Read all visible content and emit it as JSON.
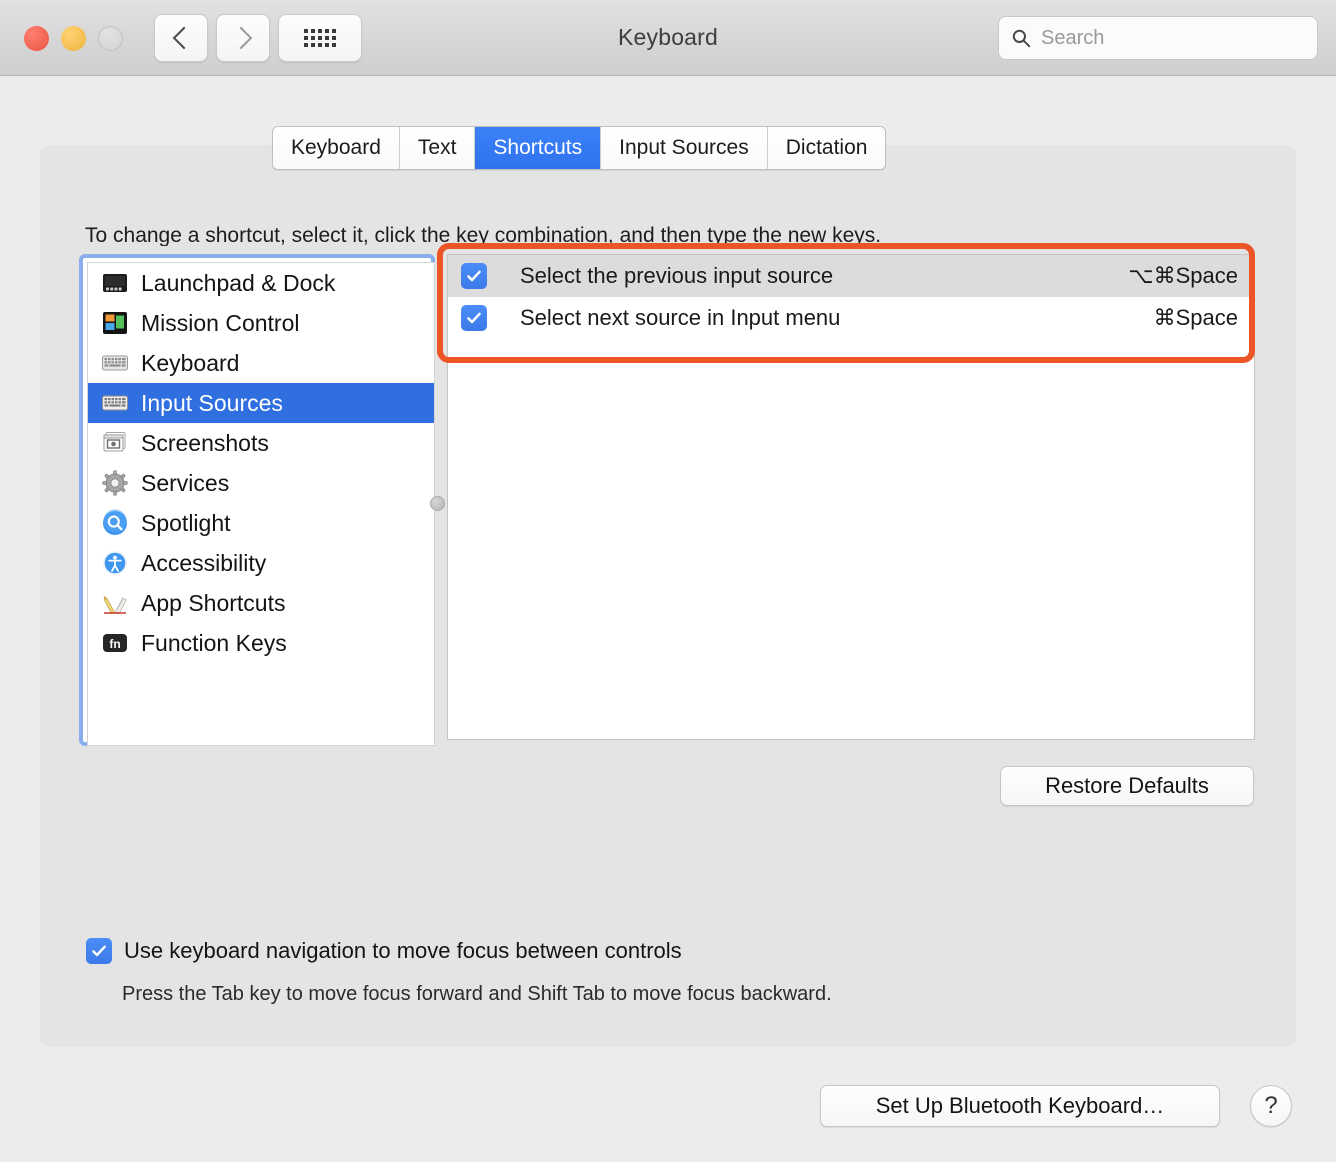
{
  "window": {
    "title": "Keyboard",
    "traffic_lights": [
      "close",
      "minimize",
      "zoom"
    ],
    "back_label": "Back",
    "forward_label": "Forward",
    "grid_label": "Show All"
  },
  "search": {
    "placeholder": "Search",
    "value": "",
    "icon": "search-icon"
  },
  "tabs": [
    {
      "label": "Keyboard",
      "active": false
    },
    {
      "label": "Text",
      "active": false
    },
    {
      "label": "Shortcuts",
      "active": true
    },
    {
      "label": "Input Sources",
      "active": false
    },
    {
      "label": "Dictation",
      "active": false
    }
  ],
  "instruction": "To change a shortcut, select it, click the key combination, and then type the new keys.",
  "sidebar": {
    "items": [
      {
        "label": "Launchpad & Dock",
        "icon": "launchpad-dock-icon",
        "selected": false
      },
      {
        "label": "Mission Control",
        "icon": "mission-control-icon",
        "selected": false
      },
      {
        "label": "Keyboard",
        "icon": "keyboard-icon",
        "selected": false
      },
      {
        "label": "Input Sources",
        "icon": "input-sources-icon",
        "selected": true
      },
      {
        "label": "Screenshots",
        "icon": "screenshots-icon",
        "selected": false
      },
      {
        "label": "Services",
        "icon": "services-gear-icon",
        "selected": false
      },
      {
        "label": "Spotlight",
        "icon": "spotlight-icon",
        "selected": false
      },
      {
        "label": "Accessibility",
        "icon": "accessibility-icon",
        "selected": false
      },
      {
        "label": "App Shortcuts",
        "icon": "app-shortcuts-icon",
        "selected": false
      },
      {
        "label": "Function Keys",
        "icon": "function-keys-icon",
        "selected": false
      }
    ]
  },
  "shortcuts": [
    {
      "checked": true,
      "label": "Select the previous input source",
      "key": "⌥⌘Space"
    },
    {
      "checked": true,
      "label": "Select next source in Input menu",
      "key": "⌘Space"
    }
  ],
  "buttons": {
    "restore_defaults": "Restore Defaults",
    "bluetooth_keyboard": "Set Up Bluetooth Keyboard…",
    "help": "?"
  },
  "keyboard_navigation": {
    "checked": true,
    "label": "Use keyboard navigation to move focus between controls",
    "note": "Press the Tab key to move focus forward and Shift Tab to move focus backward."
  },
  "colors": {
    "accent_blue": "#2f6fe0",
    "tab_active_blue": "#3b82f8",
    "checkbox_blue": "#4b8df8",
    "annotation_red": "#ec5526",
    "focus_ring": "#8aaded",
    "window_bg": "#ececec",
    "pane_bg": "#e4e4e4"
  },
  "annotation": {
    "shape": "rounded-rectangle",
    "target": "shortcut-list-rows"
  }
}
